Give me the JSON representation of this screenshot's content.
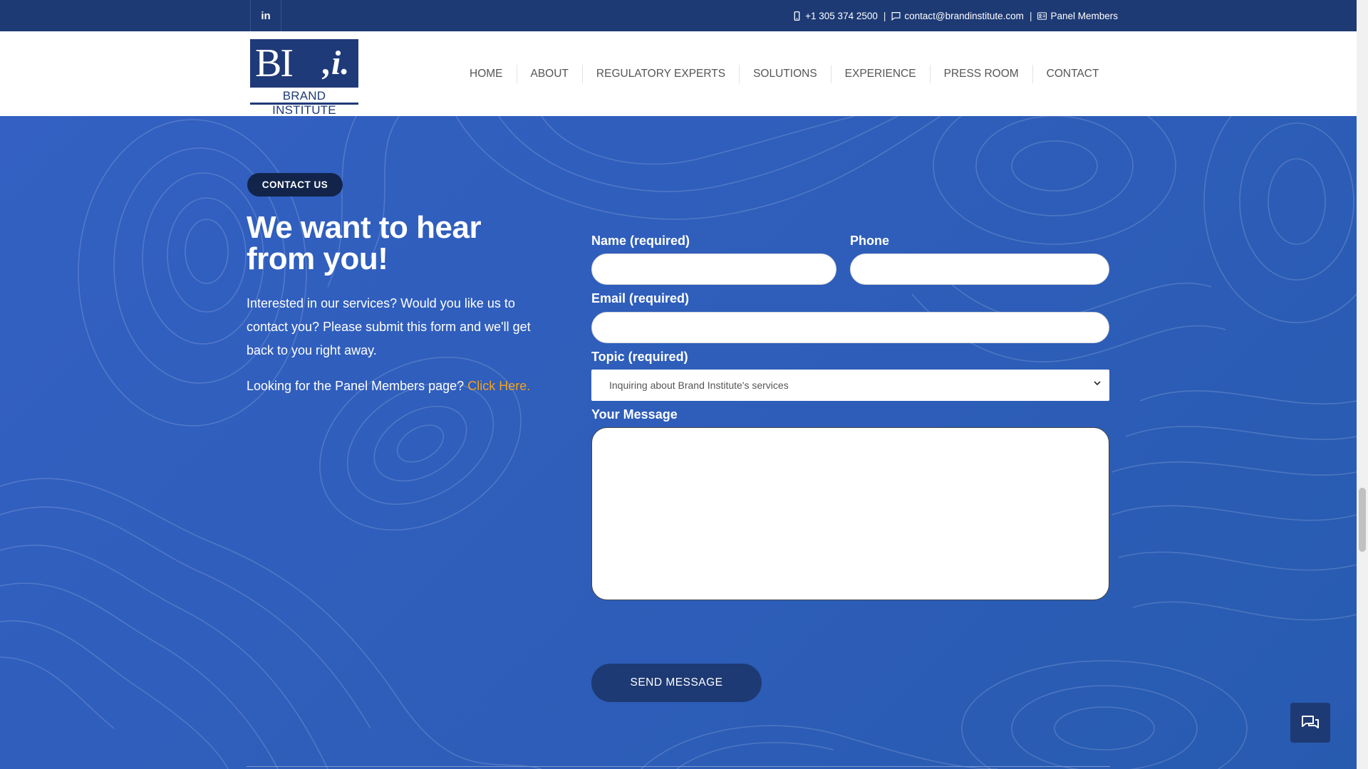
{
  "topbar": {
    "linkedin_label": "in",
    "phone": "+1 305 374 2500",
    "email": "contact@brandinstitute.com",
    "panel_members": "Panel Members",
    "separator": "|"
  },
  "logo": {
    "mark_left": "BI",
    "mark_right": ",i.",
    "name": "BRAND INSTITUTE"
  },
  "nav": {
    "items": [
      "HOME",
      "ABOUT",
      "REGULATORY EXPERTS",
      "SOLUTIONS",
      "EXPERIENCE",
      "PRESS ROOM",
      "CONTACT"
    ]
  },
  "contact": {
    "badge": "CONTACT US",
    "headline": "We want to hear from you!",
    "intro": "Interested in our services? Would you like us to contact you? Please submit this form and we'll get back to you right away.",
    "panel_text": "Looking for the Panel Members page?",
    "panel_link": "Click Here."
  },
  "form": {
    "name_label": "Name (required)",
    "phone_label": "Phone",
    "email_label": "Email (required)",
    "topic_label": "Topic (required)",
    "topic_value": "Inquiring about Brand Institute's services",
    "message_label": "Your Message",
    "name_value": "",
    "phone_value": "",
    "email_value": "",
    "message_value": "",
    "submit_label": "SEND MESSAGE"
  },
  "colors": {
    "navy": "#1e3a74",
    "background_blue": "#2f5fb8",
    "link_orange": "#f6a21b",
    "badge_dark": "#12244a"
  },
  "icons": {
    "linkedin": "linkedin-icon",
    "phone": "phone-icon",
    "email": "chat-bubble-icon",
    "panel": "id-card-icon",
    "chat": "chat-icon",
    "select": "chevron-down-icon"
  }
}
